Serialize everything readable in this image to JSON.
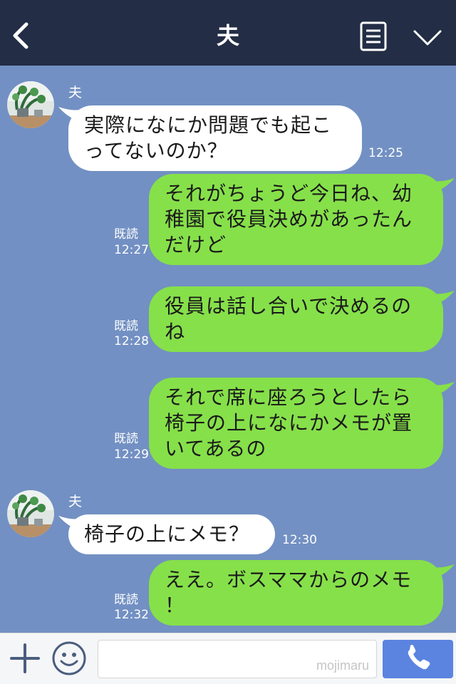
{
  "header": {
    "title": "夫",
    "back_icon": "chevron-left-icon",
    "menu_icon": "notes-icon",
    "collapse_icon": "chevron-down-icon"
  },
  "messages": [
    {
      "direction": "in",
      "sender": "夫",
      "lines": [
        "実際になにか問題でも起こ",
        "ってないのか？"
      ],
      "time": "12:25"
    },
    {
      "direction": "out",
      "read": "既読",
      "lines": [
        "それがちょうど今日ね、幼",
        "稚園で役員決めがあったん",
        "だけど"
      ],
      "time": "12:27"
    },
    {
      "direction": "out",
      "read": "既読",
      "lines": [
        "役員は話し合いで決めるの",
        "ね"
      ],
      "time": "12:28"
    },
    {
      "direction": "out",
      "read": "既読",
      "lines": [
        "それで席に座ろうとしたら",
        "椅子の上になにかメモが置",
        "いてあるの"
      ],
      "time": "12:29"
    },
    {
      "direction": "in",
      "sender": "夫",
      "lines": [
        "椅子の上にメモ？"
      ],
      "time": "12:30"
    },
    {
      "direction": "out",
      "read": "既読",
      "lines": [
        "ええ。ボスママからのメモ",
        "！"
      ],
      "time": "12:32"
    }
  ],
  "footer": {
    "plus_icon": "plus-icon",
    "emoji_icon": "smiley-icon",
    "input_value": "",
    "watermark": "mojimaru",
    "call_icon": "phone-icon"
  },
  "colors": {
    "header_bg": "#232d45",
    "chat_bg": "#7290c3",
    "bubble_in": "#ffffff",
    "bubble_out": "#86e04a",
    "call_button": "#5b84e0"
  }
}
